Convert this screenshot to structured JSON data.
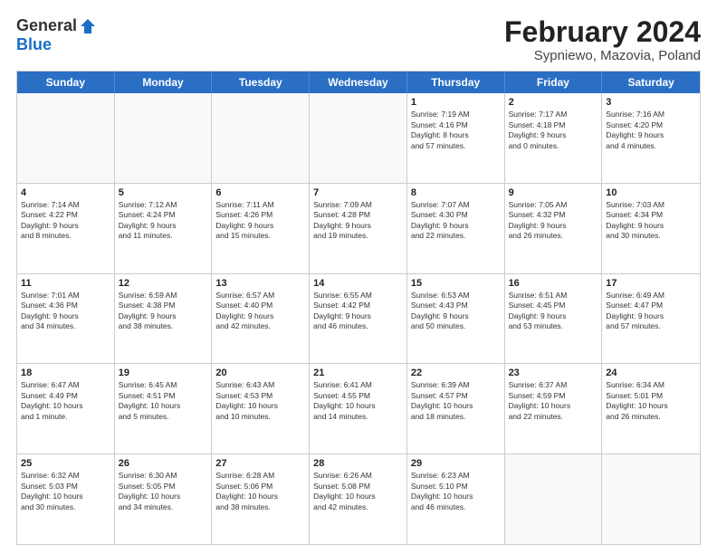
{
  "logo": {
    "general": "General",
    "blue": "Blue"
  },
  "title": "February 2024",
  "subtitle": "Sypniewo, Mazovia, Poland",
  "header_days": [
    "Sunday",
    "Monday",
    "Tuesday",
    "Wednesday",
    "Thursday",
    "Friday",
    "Saturday"
  ],
  "weeks": [
    [
      {
        "day": "",
        "info": ""
      },
      {
        "day": "",
        "info": ""
      },
      {
        "day": "",
        "info": ""
      },
      {
        "day": "",
        "info": ""
      },
      {
        "day": "1",
        "info": "Sunrise: 7:19 AM\nSunset: 4:16 PM\nDaylight: 8 hours\nand 57 minutes."
      },
      {
        "day": "2",
        "info": "Sunrise: 7:17 AM\nSunset: 4:18 PM\nDaylight: 9 hours\nand 0 minutes."
      },
      {
        "day": "3",
        "info": "Sunrise: 7:16 AM\nSunset: 4:20 PM\nDaylight: 9 hours\nand 4 minutes."
      }
    ],
    [
      {
        "day": "4",
        "info": "Sunrise: 7:14 AM\nSunset: 4:22 PM\nDaylight: 9 hours\nand 8 minutes."
      },
      {
        "day": "5",
        "info": "Sunrise: 7:12 AM\nSunset: 4:24 PM\nDaylight: 9 hours\nand 11 minutes."
      },
      {
        "day": "6",
        "info": "Sunrise: 7:11 AM\nSunset: 4:26 PM\nDaylight: 9 hours\nand 15 minutes."
      },
      {
        "day": "7",
        "info": "Sunrise: 7:09 AM\nSunset: 4:28 PM\nDaylight: 9 hours\nand 19 minutes."
      },
      {
        "day": "8",
        "info": "Sunrise: 7:07 AM\nSunset: 4:30 PM\nDaylight: 9 hours\nand 22 minutes."
      },
      {
        "day": "9",
        "info": "Sunrise: 7:05 AM\nSunset: 4:32 PM\nDaylight: 9 hours\nand 26 minutes."
      },
      {
        "day": "10",
        "info": "Sunrise: 7:03 AM\nSunset: 4:34 PM\nDaylight: 9 hours\nand 30 minutes."
      }
    ],
    [
      {
        "day": "11",
        "info": "Sunrise: 7:01 AM\nSunset: 4:36 PM\nDaylight: 9 hours\nand 34 minutes."
      },
      {
        "day": "12",
        "info": "Sunrise: 6:59 AM\nSunset: 4:38 PM\nDaylight: 9 hours\nand 38 minutes."
      },
      {
        "day": "13",
        "info": "Sunrise: 6:57 AM\nSunset: 4:40 PM\nDaylight: 9 hours\nand 42 minutes."
      },
      {
        "day": "14",
        "info": "Sunrise: 6:55 AM\nSunset: 4:42 PM\nDaylight: 9 hours\nand 46 minutes."
      },
      {
        "day": "15",
        "info": "Sunrise: 6:53 AM\nSunset: 4:43 PM\nDaylight: 9 hours\nand 50 minutes."
      },
      {
        "day": "16",
        "info": "Sunrise: 6:51 AM\nSunset: 4:45 PM\nDaylight: 9 hours\nand 53 minutes."
      },
      {
        "day": "17",
        "info": "Sunrise: 6:49 AM\nSunset: 4:47 PM\nDaylight: 9 hours\nand 57 minutes."
      }
    ],
    [
      {
        "day": "18",
        "info": "Sunrise: 6:47 AM\nSunset: 4:49 PM\nDaylight: 10 hours\nand 1 minute."
      },
      {
        "day": "19",
        "info": "Sunrise: 6:45 AM\nSunset: 4:51 PM\nDaylight: 10 hours\nand 5 minutes."
      },
      {
        "day": "20",
        "info": "Sunrise: 6:43 AM\nSunset: 4:53 PM\nDaylight: 10 hours\nand 10 minutes."
      },
      {
        "day": "21",
        "info": "Sunrise: 6:41 AM\nSunset: 4:55 PM\nDaylight: 10 hours\nand 14 minutes."
      },
      {
        "day": "22",
        "info": "Sunrise: 6:39 AM\nSunset: 4:57 PM\nDaylight: 10 hours\nand 18 minutes."
      },
      {
        "day": "23",
        "info": "Sunrise: 6:37 AM\nSunset: 4:59 PM\nDaylight: 10 hours\nand 22 minutes."
      },
      {
        "day": "24",
        "info": "Sunrise: 6:34 AM\nSunset: 5:01 PM\nDaylight: 10 hours\nand 26 minutes."
      }
    ],
    [
      {
        "day": "25",
        "info": "Sunrise: 6:32 AM\nSunset: 5:03 PM\nDaylight: 10 hours\nand 30 minutes."
      },
      {
        "day": "26",
        "info": "Sunrise: 6:30 AM\nSunset: 5:05 PM\nDaylight: 10 hours\nand 34 minutes."
      },
      {
        "day": "27",
        "info": "Sunrise: 6:28 AM\nSunset: 5:06 PM\nDaylight: 10 hours\nand 38 minutes."
      },
      {
        "day": "28",
        "info": "Sunrise: 6:26 AM\nSunset: 5:08 PM\nDaylight: 10 hours\nand 42 minutes."
      },
      {
        "day": "29",
        "info": "Sunrise: 6:23 AM\nSunset: 5:10 PM\nDaylight: 10 hours\nand 46 minutes."
      },
      {
        "day": "",
        "info": ""
      },
      {
        "day": "",
        "info": ""
      }
    ]
  ]
}
